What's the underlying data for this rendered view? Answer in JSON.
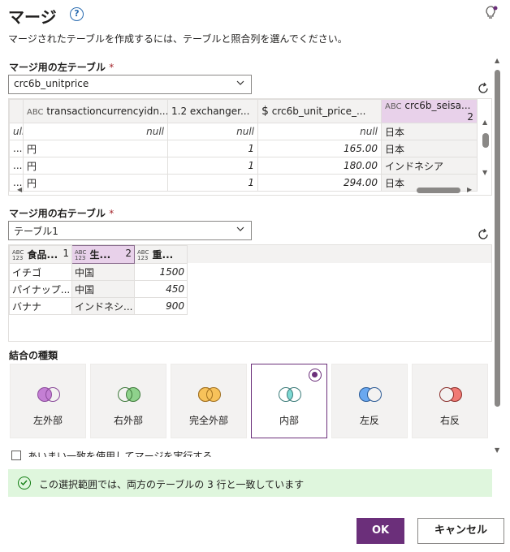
{
  "dialog": {
    "title": "マージ",
    "subtitle": "マージされたテーブルを作成するには、テーブルと照合列を選んでください。",
    "help_icon": "help-circle-icon",
    "idea_icon": "lightbulb-icon"
  },
  "left_table": {
    "label": "マージ用の左テーブル",
    "required_mark": "*",
    "selected": "crc6b_unitprice",
    "columns": [
      {
        "type": "ABC",
        "name": "transactioncurrencyidn..."
      },
      {
        "type": "1.2",
        "name": "exchanger..."
      },
      {
        "type": "$",
        "name": "crc6b_unit_price_..."
      },
      {
        "type": "ABC",
        "name": "crc6b_seisa...",
        "order": "2"
      }
    ],
    "rows": [
      {
        "c0": "ull",
        "c1": "null",
        "c2": "null",
        "c3": "null",
        "c4": "日本"
      },
      {
        "c0": "...",
        "c1": "円",
        "c2": "1",
        "c3": "165.00",
        "c4": "日本"
      },
      {
        "c0": "...",
        "c1": "円",
        "c2": "1",
        "c3": "180.00",
        "c4": "インドネシア"
      },
      {
        "c0": "...",
        "c1": "円",
        "c2": "1",
        "c3": "294.00",
        "c4": "日本"
      }
    ]
  },
  "right_table": {
    "label": "マージ用の右テーブル",
    "required_mark": "*",
    "selected": "テーブル1",
    "columns": [
      {
        "type_top": "ABC",
        "type_bottom": "123",
        "name": "食品...",
        "order": "1"
      },
      {
        "type_top": "ABC",
        "type_bottom": "123",
        "name": "生...",
        "order": "2"
      },
      {
        "type_top": "ABC",
        "type_bottom": "123",
        "name": "重..."
      }
    ],
    "rows": [
      {
        "c1": "イチゴ",
        "c2": "中国",
        "c3": "1500"
      },
      {
        "c1": "パイナップ...",
        "c2": "中国",
        "c3": "450"
      },
      {
        "c1": "バナナ",
        "c2": "インドネシ...",
        "c3": "900"
      }
    ]
  },
  "join": {
    "label": "結合の種類",
    "options": [
      {
        "label": "左外部",
        "selected": false
      },
      {
        "label": "右外部",
        "selected": false
      },
      {
        "label": "完全外部",
        "selected": false
      },
      {
        "label": "内部",
        "selected": true
      },
      {
        "label": "左反",
        "selected": false
      },
      {
        "label": "右反",
        "selected": false
      }
    ],
    "fuzzy_label": "あいまい一致を使用してマージを実行する"
  },
  "status": {
    "message": "この選択範囲では、両方のテーブルの 3 行と一致しています"
  },
  "buttons": {
    "ok": "OK",
    "cancel": "キャンセル"
  },
  "colors": {
    "accent": "#6b2f7a",
    "success_bg": "#dff6dd",
    "success_icon": "#107c10"
  }
}
